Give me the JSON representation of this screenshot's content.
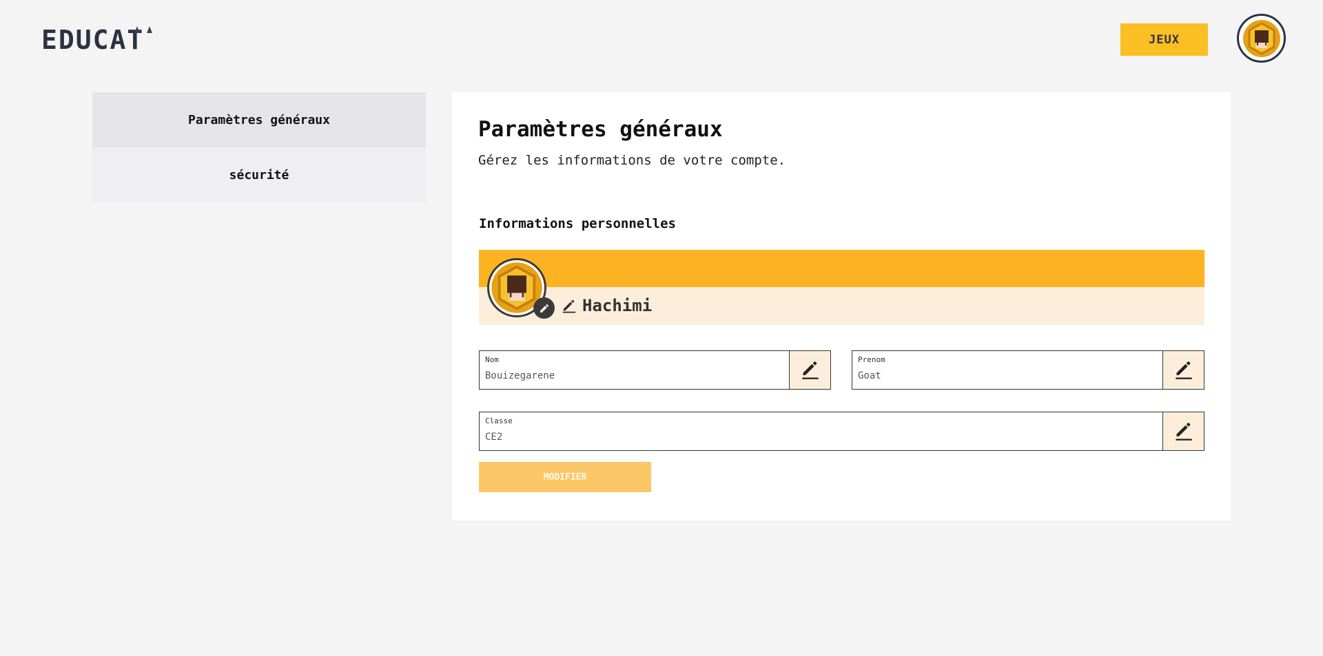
{
  "brand": {
    "logo_text": "EDUCAT"
  },
  "header": {
    "games_label": "JEUX",
    "avatar_icon": "user-avatar-icon"
  },
  "sidebar": {
    "items": [
      {
        "label": "Paramètres généraux",
        "active": true
      },
      {
        "label": "sécurité",
        "active": false
      }
    ]
  },
  "main": {
    "title": "Paramètres généraux",
    "subtitle": "Gérez les informations de votre compte.",
    "section_title": "Informations personnelles",
    "profile": {
      "username": "Hachimi",
      "avatar_icon": "user-avatar-icon",
      "edit_icon": "pencil-icon"
    },
    "fields": {
      "nom": {
        "label": "Nom",
        "value": "Bouizegarene"
      },
      "prenom": {
        "label": "Prenom",
        "value": "Goat"
      },
      "classe": {
        "label": "Classe",
        "value": "CE2"
      }
    },
    "submit_label": "MODIFIER"
  },
  "colors": {
    "accent": "#fbbf24",
    "banner": "#fbb321",
    "card_bg": "#fdeedc",
    "dark": "#2c3242",
    "button_disabled": "#fcc766"
  }
}
